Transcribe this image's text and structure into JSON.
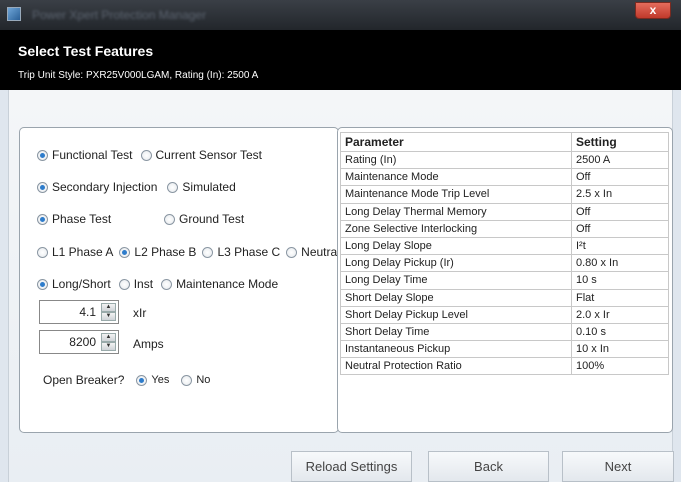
{
  "window": {
    "title": "Power Xpert Protection Manager",
    "close_label": "x"
  },
  "header": {
    "title": "Select Test Features",
    "subtitle": "Trip Unit Style: PXR25V000LGAM, Rating (In): 2500 A"
  },
  "test_options": {
    "row1": [
      {
        "label": "Functional Test",
        "selected": true
      },
      {
        "label": "Current Sensor Test",
        "selected": false
      }
    ],
    "row2": [
      {
        "label": "Secondary Injection",
        "selected": true
      },
      {
        "label": "Simulated",
        "selected": false
      }
    ],
    "row3": [
      {
        "label": "Phase Test",
        "selected": true
      },
      {
        "label": "Ground Test",
        "selected": false
      }
    ],
    "row4": [
      {
        "label": "L1 Phase A",
        "selected": false
      },
      {
        "label": "L2 Phase B",
        "selected": true
      },
      {
        "label": "L3 Phase C",
        "selected": false
      },
      {
        "label": "Neutral",
        "selected": false
      }
    ],
    "row5": [
      {
        "label": "Long/Short",
        "selected": true
      },
      {
        "label": "Inst",
        "selected": false
      },
      {
        "label": "Maintenance Mode",
        "selected": false
      }
    ],
    "multiplier": {
      "value": "4.1",
      "unit": "xIr"
    },
    "current": {
      "value": "8200",
      "unit": "Amps"
    },
    "open_breaker": {
      "label": "Open Breaker?",
      "yes": "Yes",
      "no": "No",
      "selected": "Yes"
    }
  },
  "settings_table": {
    "headers": [
      "Parameter",
      "Setting"
    ],
    "rows": [
      [
        "Rating (In)",
        "2500 A"
      ],
      [
        "Maintenance Mode",
        "Off"
      ],
      [
        "Maintenance Mode Trip Level",
        "2.5 x In"
      ],
      [
        "Long Delay Thermal Memory",
        "Off"
      ],
      [
        "Zone Selective Interlocking",
        "Off"
      ],
      [
        "Long Delay Slope",
        "I²t"
      ],
      [
        "Long Delay Pickup (Ir)",
        "0.80 x In"
      ],
      [
        "Long Delay Time",
        "10 s"
      ],
      [
        "Short Delay Slope",
        "Flat"
      ],
      [
        "Short Delay Pickup Level",
        "2.0 x Ir"
      ],
      [
        "Short Delay Time",
        "0.10 s"
      ],
      [
        "Instantaneous Pickup",
        "10 x In"
      ],
      [
        "Neutral Protection Ratio",
        "100%"
      ]
    ]
  },
  "buttons": {
    "reload": "Reload Settings",
    "back": "Back",
    "next": "Next"
  },
  "colors": {
    "header_bg": "#000000",
    "radio_selected": "#2e7ccb"
  }
}
